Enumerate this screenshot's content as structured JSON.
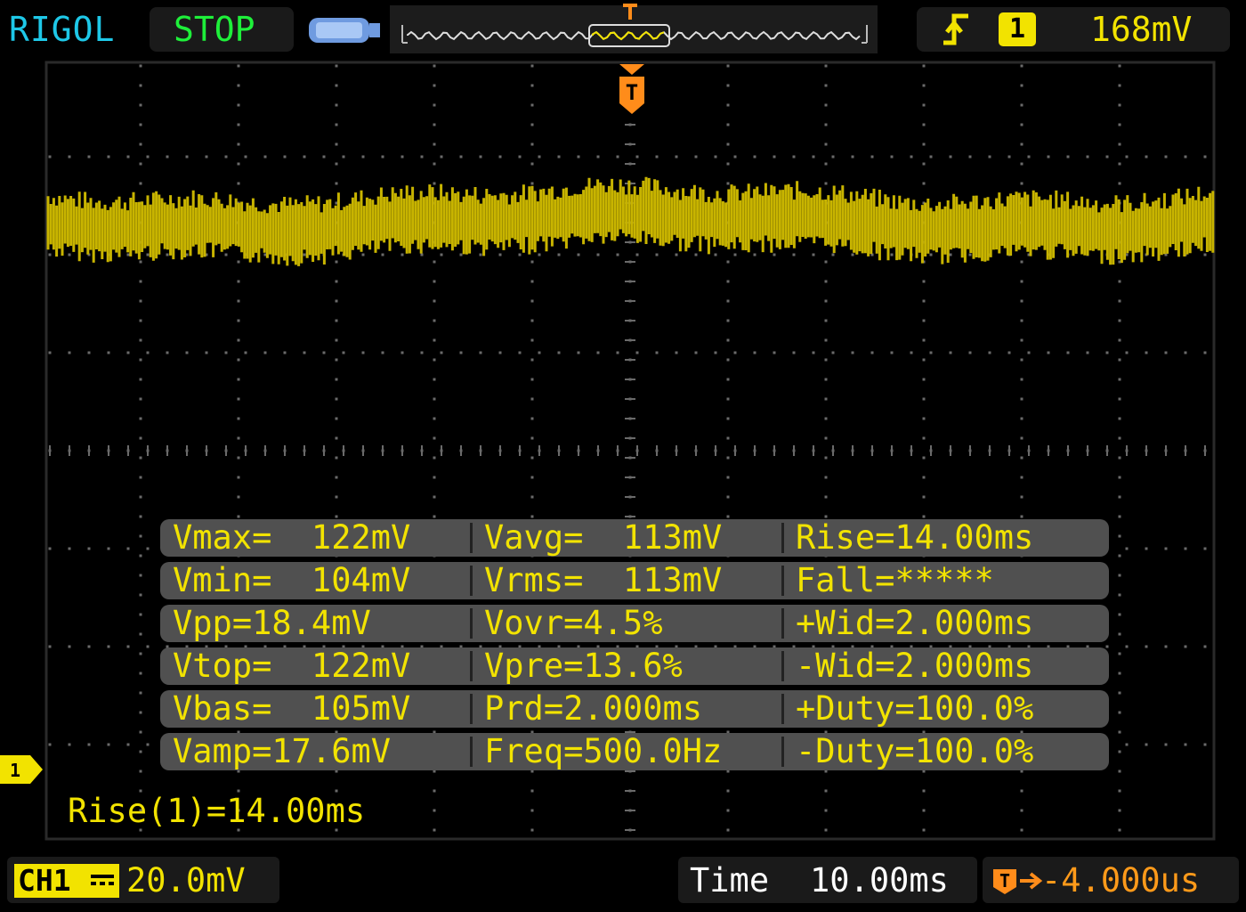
{
  "brand": "RIGOL",
  "run_status": "STOP",
  "trigger": {
    "marker_label": "T",
    "slope_icon": "rising-edge-trigger-icon",
    "source": "1",
    "level": "168mV"
  },
  "channel": {
    "marker_label": "1",
    "badge": "CH1",
    "coupling_icon": "dc-coupling-icon",
    "scale": "20.0mV"
  },
  "timebase": {
    "label": "Time",
    "scale": "10.00ms",
    "delay": "-4.000us"
  },
  "measurements": [
    [
      "Vmax=  122mV",
      "Vavg=  113mV",
      "Rise=14.00ms"
    ],
    [
      "Vmin=  104mV",
      "Vrms=  113mV",
      "Fall=*****"
    ],
    [
      "Vpp=18.4mV",
      "Vovr=4.5%",
      "+Wid=2.000ms"
    ],
    [
      "Vtop=  122mV",
      "Vpre=13.6%",
      "-Wid=2.000ms"
    ],
    [
      "Vbas=  105mV",
      "Prd=2.000ms",
      "+Duty=100.0%"
    ],
    [
      "Vamp=17.6mV",
      "Freq=500.0Hz",
      "-Duty=100.0%"
    ]
  ],
  "rise_readout": "Rise(1)=14.00ms",
  "colors": {
    "channel1": "#c8b400",
    "trigger": "#ff8c1a",
    "measurement_text": "#f2e300",
    "brand": "#1ec8e8",
    "status": "#1ef03a"
  }
}
